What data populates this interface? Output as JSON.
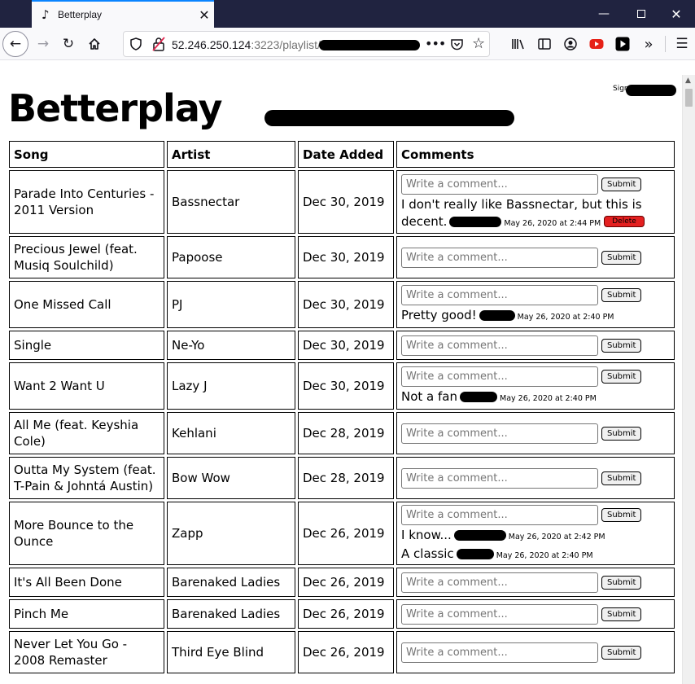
{
  "browser": {
    "tab_title": "Betterplay",
    "url_host": "52.246.250.124",
    "url_rest": ":3223/playlist/"
  },
  "page": {
    "logo": "Betterplay",
    "signed_in_label": "Signed in as",
    "comment_placeholder": "Write a comment...",
    "submit_label": "Submit",
    "delete_label": "Delete"
  },
  "table": {
    "headers": [
      "Song",
      "Artist",
      "Date Added",
      "Comments"
    ],
    "rows": [
      {
        "song": "Parade Into Centuries - 2011 Version",
        "artist": "Bassnectar",
        "date": "Dec 30, 2019",
        "comments": [
          {
            "text": "I don't really like Bassnectar, but this is decent.",
            "meta": "May 26, 2020 at 2:44 PM",
            "deletable": true
          }
        ]
      },
      {
        "song": "Precious Jewel (feat. Musiq Soulchild)",
        "artist": "Papoose",
        "date": "Dec 30, 2019",
        "comments": []
      },
      {
        "song": "One Missed Call",
        "artist": "PJ",
        "date": "Dec 30, 2019",
        "comments": [
          {
            "text": "Pretty good!",
            "meta": "May 26, 2020 at 2:40 PM",
            "deletable": false
          }
        ]
      },
      {
        "song": "Single",
        "artist": "Ne-Yo",
        "date": "Dec 30, 2019",
        "comments": []
      },
      {
        "song": "Want 2 Want U",
        "artist": "Lazy J",
        "date": "Dec 30, 2019",
        "comments": [
          {
            "text": "Not a fan",
            "meta": "May 26, 2020 at 2:40 PM",
            "deletable": false
          }
        ]
      },
      {
        "song": "All Me (feat. Keyshia Cole)",
        "artist": "Kehlani",
        "date": "Dec 28, 2019",
        "comments": []
      },
      {
        "song": "Outta My System (feat. T-Pain & Johntá Austin)",
        "artist": "Bow Wow",
        "date": "Dec 28, 2019",
        "comments": []
      },
      {
        "song": "More Bounce to the Ounce",
        "artist": "Zapp",
        "date": "Dec 26, 2019",
        "comments": [
          {
            "text": "I know...",
            "meta": "May 26, 2020 at 2:42 PM",
            "deletable": false
          },
          {
            "text": "A classic",
            "meta": "May 26, 2020 at 2:40 PM",
            "deletable": false
          }
        ]
      },
      {
        "song": "It's All Been Done",
        "artist": "Barenaked Ladies",
        "date": "Dec 26, 2019",
        "comments": []
      },
      {
        "song": "Pinch Me",
        "artist": "Barenaked Ladies",
        "date": "Dec 26, 2019",
        "comments": []
      },
      {
        "song": "Never Let You Go - 2008 Remaster",
        "artist": "Third Eye Blind",
        "date": "Dec 26, 2019",
        "comments": []
      }
    ]
  }
}
